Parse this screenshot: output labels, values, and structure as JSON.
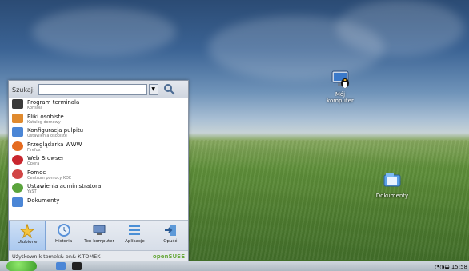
{
  "desktop": {
    "icons": [
      {
        "label_1": "Mój",
        "label_2": "komputer",
        "icon": "computer-icon"
      },
      {
        "label": "Dokumenty",
        "icon": "documents-icon"
      }
    ]
  },
  "menu": {
    "search_label": "Szukaj:",
    "search_value": "",
    "items": [
      {
        "title": "Program terminala",
        "subtitle": "Konsola",
        "icon": "terminal-icon",
        "color": "#3a3a3a"
      },
      {
        "title": "Pliki osobiste",
        "subtitle": "Katalog domowy",
        "icon": "home-folder-icon",
        "color": "#e08a2e"
      },
      {
        "title": "Konfiguracja pulpitu",
        "subtitle": "Ustawienia osobiste",
        "icon": "desktop-settings-icon",
        "color": "#4b86d6"
      },
      {
        "title": "Przeglądarka WWW",
        "subtitle": "Firefox",
        "icon": "firefox-icon",
        "color": "#e56b1f"
      },
      {
        "title": "Web Browser",
        "subtitle": "Opera",
        "icon": "opera-icon",
        "color": "#c9262e"
      },
      {
        "title": "Pomoc",
        "subtitle": "Centrum pomocy KDE",
        "icon": "help-lifebuoy-icon",
        "color": "#d24646"
      },
      {
        "title": "Ustawienia administratora",
        "subtitle": "YaST",
        "icon": "yast-icon",
        "color": "#5aa43c"
      },
      {
        "title": "Dokumenty",
        "subtitle": "",
        "icon": "documents-folder-icon",
        "color": "#4b86d6"
      }
    ],
    "tabs": [
      {
        "label": "Ulubione",
        "icon": "star-icon",
        "color": "#f5c542"
      },
      {
        "label": "Historia",
        "icon": "clock-icon",
        "color": "#5a92d9"
      },
      {
        "label": "Ten komputer",
        "icon": "computer-icon",
        "color": "#6d8fc4"
      },
      {
        "label": "Aplikacje",
        "icon": "applications-icon",
        "color": "#4a8fd6"
      },
      {
        "label": "Opuść",
        "icon": "leave-icon",
        "color": "#5d99d8"
      }
    ],
    "user_text": "Użytkownik tomek& on& K-TOMEK",
    "brand": "openSUSE"
  },
  "taskbar": {
    "clock": "15:58"
  }
}
